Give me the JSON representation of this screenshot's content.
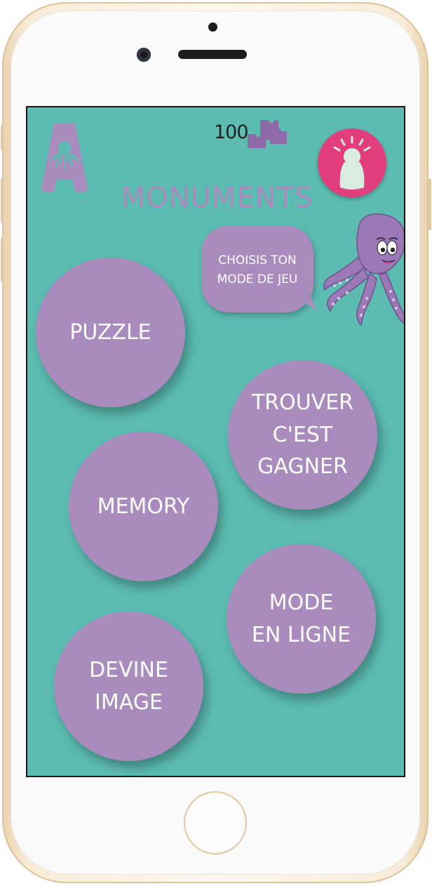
{
  "header": {
    "score": "100",
    "title": "MONUMENTS"
  },
  "bubble": {
    "line1": "CHOISIS TON",
    "line2": "MODE DE JEU"
  },
  "modes": {
    "puzzle": {
      "line1": "PUZZLE"
    },
    "trouver": {
      "line1": "TROUVER",
      "line2": "C'EST",
      "line3": "GAGNER"
    },
    "memory": {
      "line1": "MEMORY"
    },
    "en_ligne": {
      "line1": "MODE",
      "line2": "EN LIGNE"
    },
    "devine": {
      "line1": "DEVINE",
      "line2": "IMAGE"
    }
  },
  "icons": {
    "logo": "octopus-letter-a-logo",
    "score": "puzzle-pieces-icon",
    "hint": "lightbulb-icon",
    "mascot": "octopus-mascot"
  },
  "colors": {
    "background": "#5cbcb1",
    "accent_purple": "#a98bbd",
    "hint_pink": "#e23d7c",
    "text_white": "#ffffff"
  }
}
